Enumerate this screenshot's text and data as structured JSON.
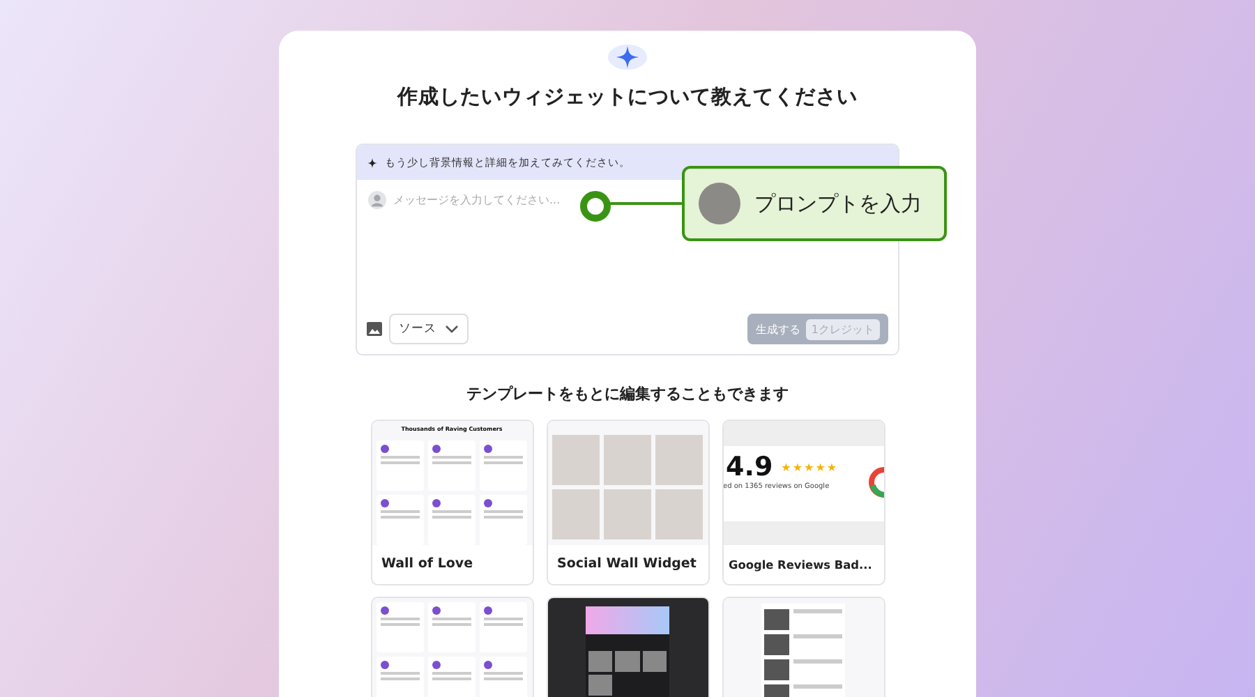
{
  "title": "作成したいウィジェットについて教えてください",
  "prompt_box": {
    "hint": "もう少し背景情報と詳細を加えてみてください。",
    "placeholder": "メッセージを入力してください...",
    "source_label": "ソース",
    "generate_button": {
      "label": "生成する",
      "credit": "1クレジット",
      "disabled": true
    }
  },
  "callout": {
    "label": "プロンプトを入力"
  },
  "templates_heading": "テンプレートをもとに編集することもできます",
  "templates": [
    {
      "kind": "wall",
      "name": "Wall of Love",
      "thumb_title": "Thousands of Raving Customers"
    },
    {
      "kind": "social",
      "name": "Social Wall Widget"
    },
    {
      "kind": "google",
      "name": "Google Reviews Bad...",
      "rating": "4.9",
      "stars": 5,
      "caption": "ed on 1365 reviews on Google"
    },
    {
      "kind": "wall2"
    },
    {
      "kind": "dark"
    },
    {
      "kind": "feed"
    }
  ]
}
